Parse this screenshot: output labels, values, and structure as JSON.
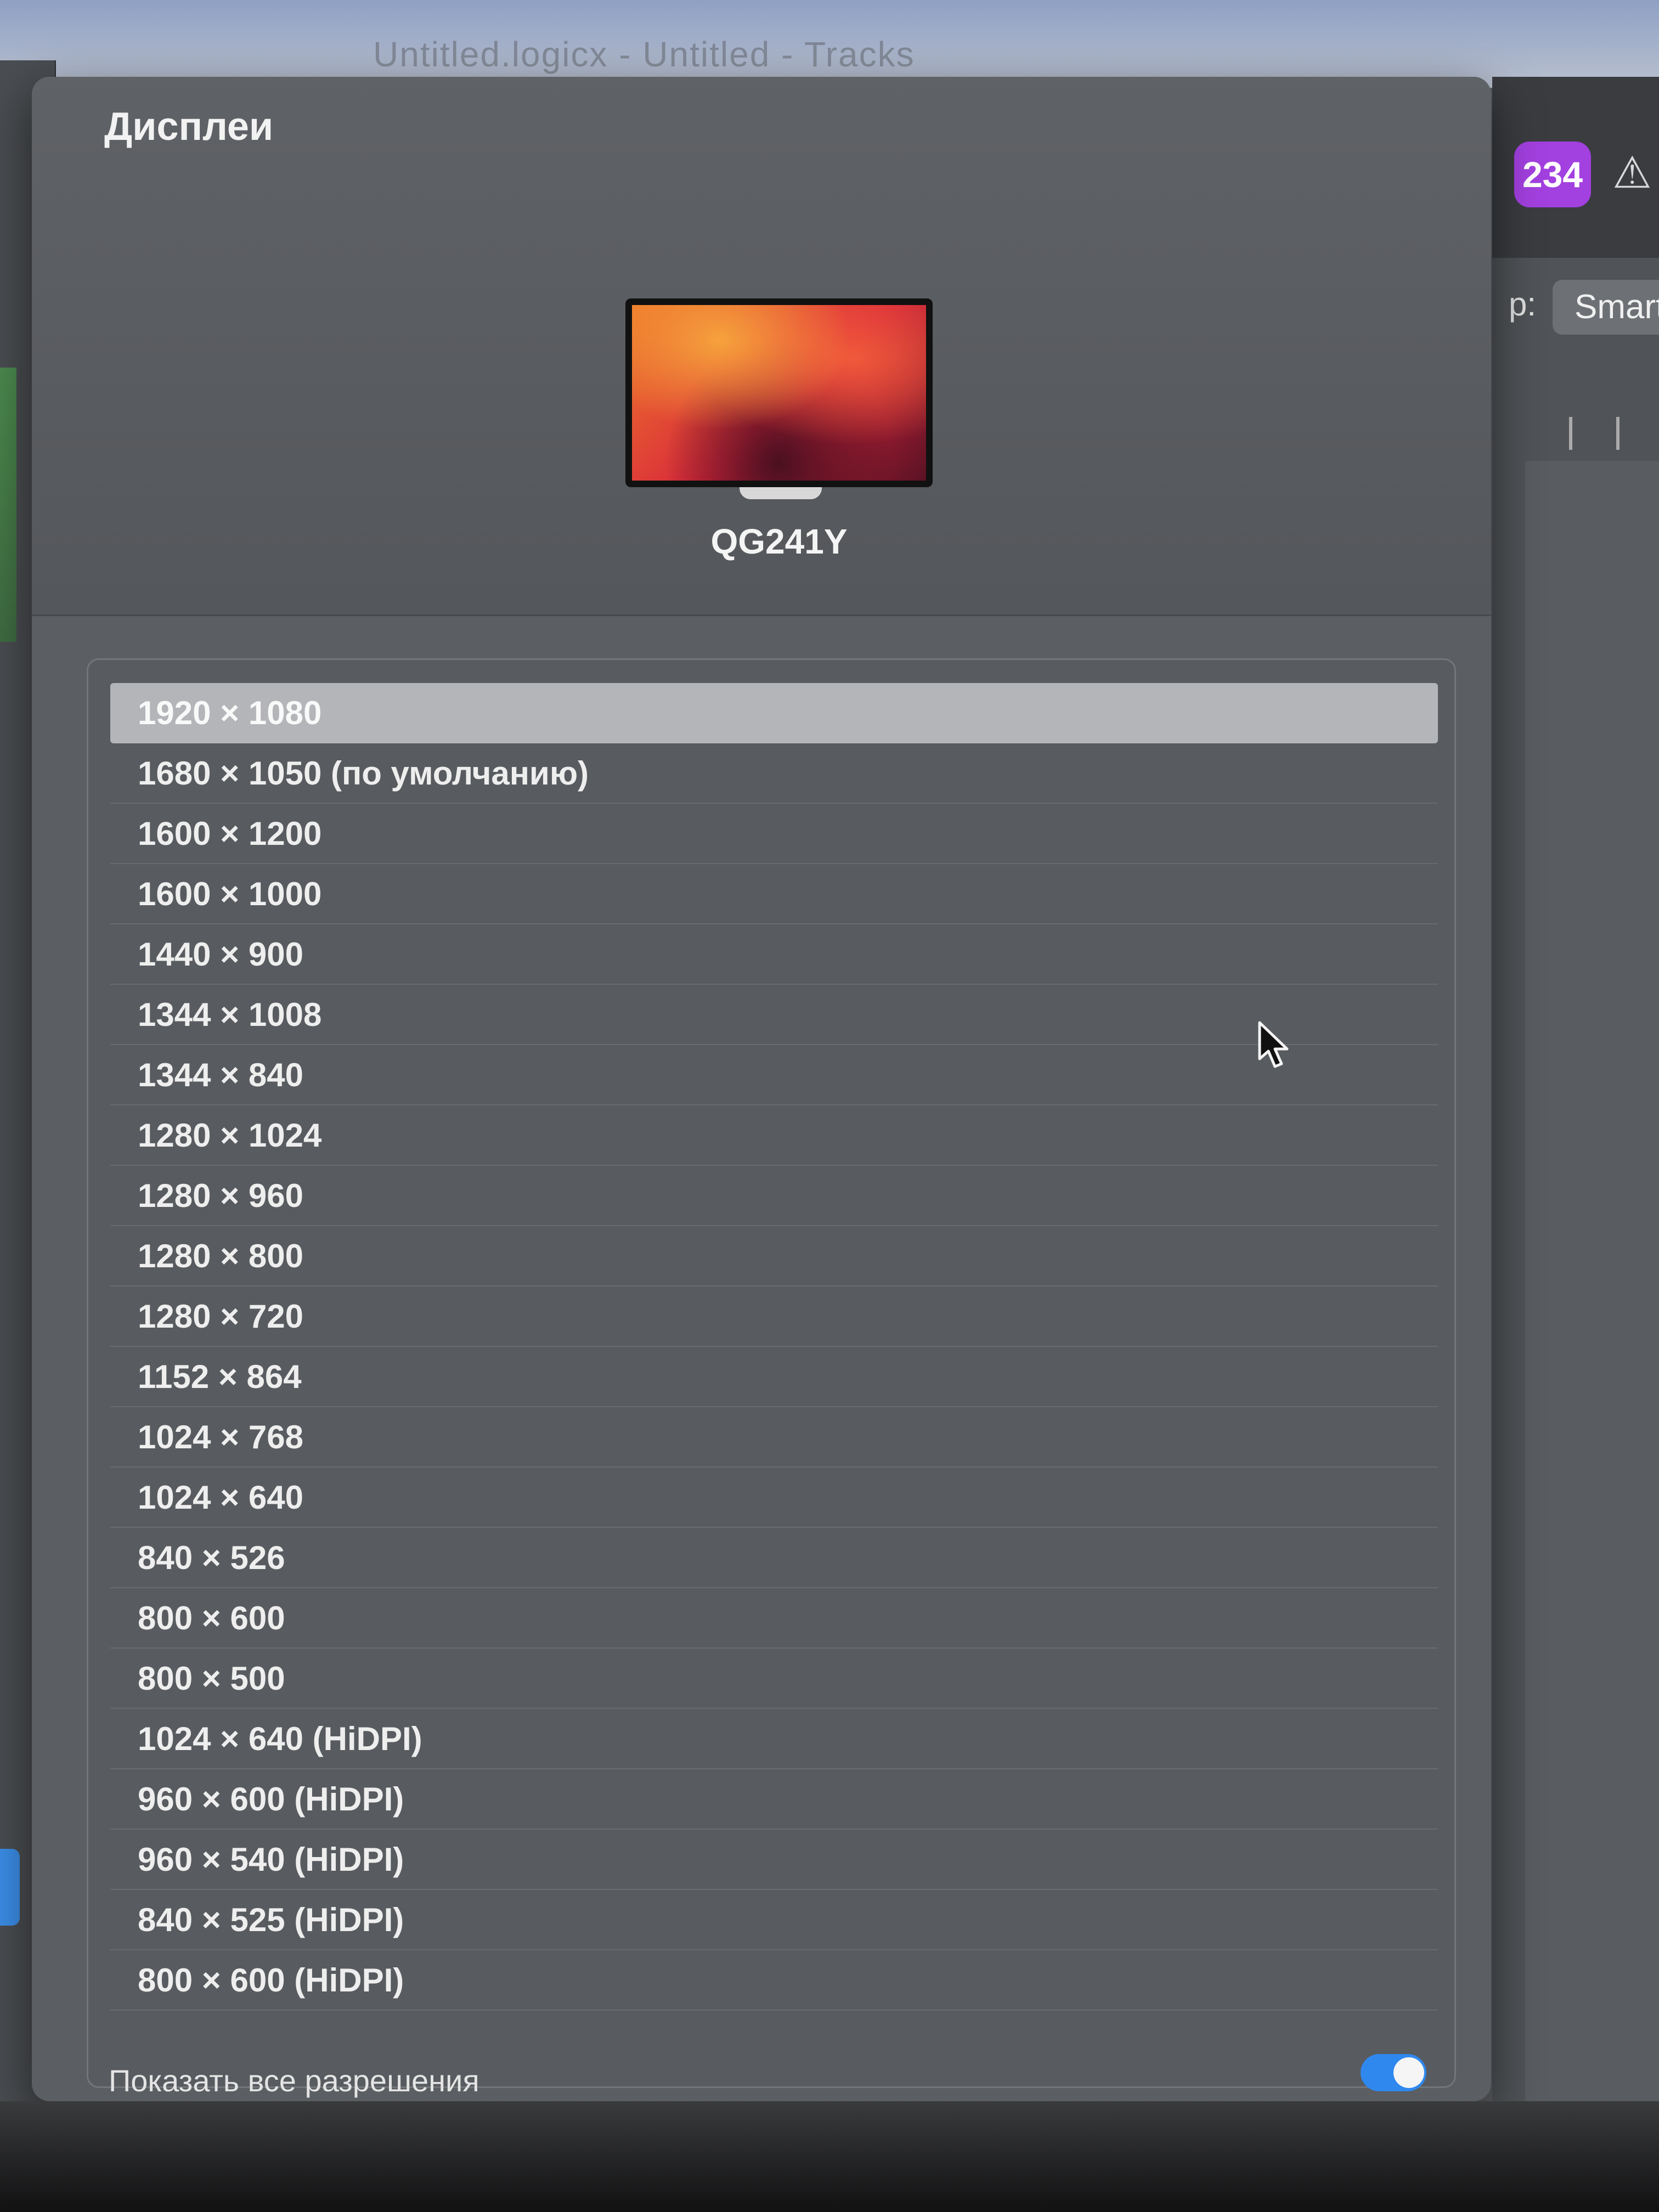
{
  "background": {
    "ghost_title": "Untitled.logicx - Untitled - Tracks"
  },
  "right_app": {
    "badge": "234",
    "tuner_icon": "tuner-icon",
    "colon": "p:",
    "smart_button": "Smart"
  },
  "panel": {
    "title": "Дисплеи",
    "monitor_name": "QG241Y",
    "resolutions": [
      "1920 × 1080",
      "1680 × 1050 (по умолчанию)",
      "1600 × 1200",
      "1600 × 1000",
      "1440 × 900",
      "1344 × 1008",
      "1344 × 840",
      "1280 × 1024",
      "1280 × 960",
      "1280 × 800",
      "1280 × 720",
      "1152 × 864",
      "1024 × 768",
      "1024 × 640",
      "840 × 526",
      "800 × 600",
      "800 × 500",
      "1024 × 640 (HiDPI)",
      "960 × 600 (HiDPI)",
      "960 × 540 (HiDPI)",
      "840 × 525 (HiDPI)",
      "800 × 600 (HiDPI)"
    ],
    "selected_resolution": "1920 × 1080",
    "show_all_label": "Показать все разрешения",
    "show_all_enabled": true
  },
  "colors": {
    "panel_bg": "#5b5e62",
    "selection": "#b3b5b8",
    "toggle_on": "#2f88ee",
    "badge": "#a340e0"
  }
}
